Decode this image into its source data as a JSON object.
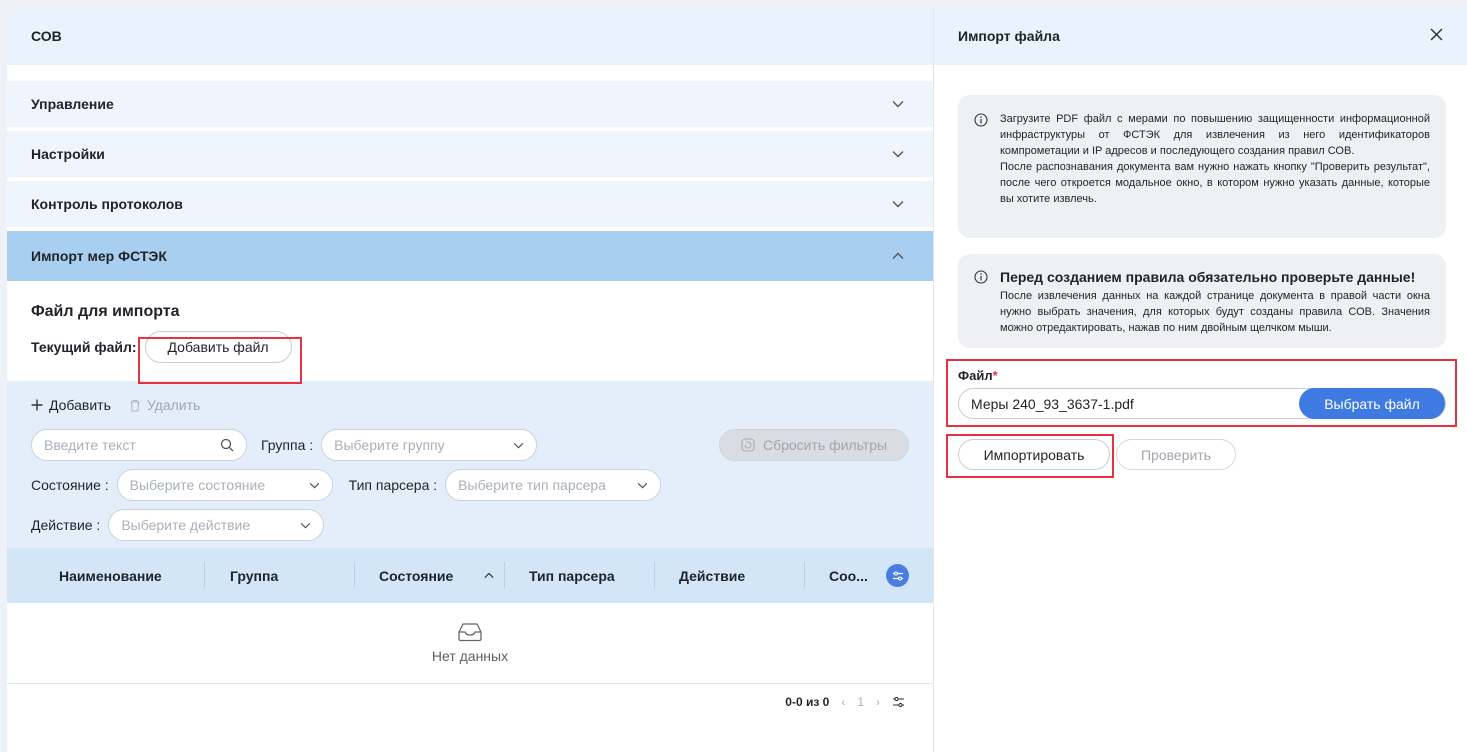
{
  "left": {
    "title": "СОВ",
    "accordion": [
      {
        "label": "Управление",
        "expanded": false
      },
      {
        "label": "Настройки",
        "expanded": false
      },
      {
        "label": "Контроль протоколов",
        "expanded": false
      },
      {
        "label": "Импорт мер ФСТЭК",
        "expanded": true
      }
    ],
    "import": {
      "section_title": "Файл для импорта",
      "current_file_label": "Текущий файл:",
      "add_file_button": "Добавить файл"
    },
    "toolbar": {
      "add_label": "Добавить",
      "delete_label": "Удалить"
    },
    "filters": {
      "search_placeholder": "Введите текст",
      "group_label": "Группа",
      "group_placeholder": "Выберите группу",
      "state_label": "Состояние",
      "state_placeholder": "Выберите состояние",
      "parser_label": "Тип парсера",
      "parser_placeholder": "Выберите тип парсера",
      "action_label": "Действие",
      "action_placeholder": "Выберите действие",
      "reset_label": "Сбросить фильтры"
    },
    "table": {
      "columns": [
        "Наименование",
        "Группа",
        "Состояние",
        "Тип парсера",
        "Действие",
        "Соо..."
      ],
      "empty_text": "Нет данных"
    },
    "pager": {
      "count": "0-0 из 0",
      "page": "1"
    }
  },
  "right": {
    "title": "Импорт файла",
    "info1": "Загрузите PDF файл с мерами по повышению защищенности информационной инфраструктуры от ФСТЭК для извлечения из него идентификаторов компрометации и IP адресов и последующего создания правил СОВ.",
    "info1b": "После распознавания документа вам нужно нажать кнопку \"Проверить результат\", после чего откроется модальное окно, в котором нужно указать данные, которые вы хотите извлечь.",
    "info2_title": "Перед созданием правила обязательно проверьте данные!",
    "info2": "После извлечения данных на каждой странице документа в правой части окна нужно выбрать значения, для которых будут созданы правила СОВ. Значения можно отредактировать, нажав по ним двойным щелчком мыши.",
    "file_label": "Файл",
    "required_mark": "*",
    "file_value": "Меры 240_93_3637-1.pdf",
    "choose_button": "Выбрать файл",
    "import_button": "Импортировать",
    "check_button": "Проверить"
  },
  "colors": {
    "accent": "#3f7ae3",
    "highlight": "#e5323e",
    "active_accordion": "#a8cfef"
  }
}
